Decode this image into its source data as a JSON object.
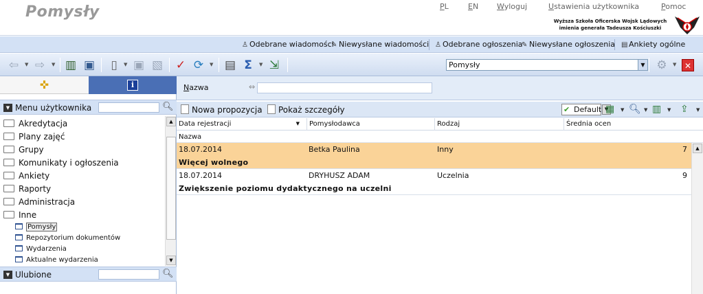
{
  "app": {
    "title": "Pomysły"
  },
  "top_links": {
    "pl": "PL",
    "en": "EN",
    "logout": "Wyloguj",
    "settings": "Ustawienia użytkownika",
    "help": "Pomoc"
  },
  "university": {
    "line1": "Wyższa Szkoła Oficerska Wojsk Lądowych",
    "line2": "imienia generała Tadeusza Kościuszki"
  },
  "message_bar": {
    "received_messages": "Odebrane wiadomości",
    "unsent_messages": "Niewysłane wiadomości",
    "received_announcements": "Odebrane ogłoszenia",
    "unsent_announcements": "Niewysłane ogłoszenia",
    "general_surveys": "Ankiety ogólne"
  },
  "toolbar": {
    "page_select_value": "Pomysły"
  },
  "sidebar": {
    "menu_title": "Menu użytkownika",
    "favorites_title": "Ulubione",
    "folders": [
      "Akredytacja",
      "Plany zajęć",
      "Grupy",
      "Komunikaty i ogłoszenia",
      "Ankiety",
      "Raporty",
      "Administracja",
      "Inne"
    ],
    "subitems": [
      "Pomysły",
      "Repozytorium dokumentów",
      "Wydarzenia",
      "Aktualne wydarzenia"
    ]
  },
  "filter": {
    "label": "Nazwa",
    "value": ""
  },
  "grid_toolbar": {
    "new_proposal": "Nowa propozycja",
    "show_details": "Pokaż szczegóły",
    "view": "Default"
  },
  "grid": {
    "columns": {
      "date": "Data rejestracji",
      "author": "Pomysłodawca",
      "kind": "Rodzaj",
      "rating": "Średnia ocen"
    },
    "subheader": "Nazwa",
    "rows": [
      {
        "date": "18.07.2014",
        "author": "Betka Paulina",
        "kind": "Inny",
        "rating": "7",
        "name": "Więcej wolnego"
      },
      {
        "date": "18.07.2014",
        "author": "DRYHUSZ ADAM",
        "kind": "Uczelnia",
        "rating": "9",
        "name": "Zwiększenie poziomu dydaktycznego na uczelni"
      }
    ]
  },
  "colors": {
    "header_band": "#d3e1f5",
    "selected_row": "#fad398",
    "info_tab": "#4a6fb5"
  }
}
